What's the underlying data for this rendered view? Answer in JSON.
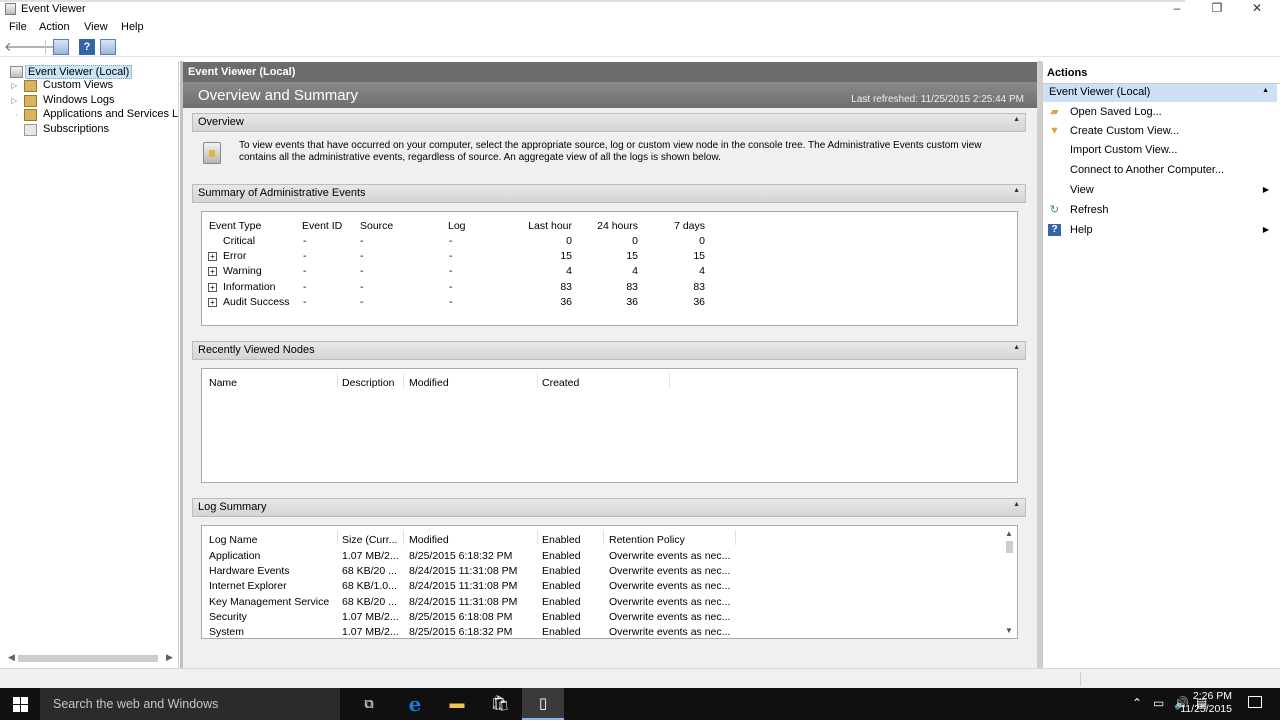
{
  "window": {
    "title": "Event Viewer",
    "controls": {
      "minimize": "–",
      "restore": "❐",
      "close": "✕"
    }
  },
  "menu": [
    "File",
    "Action",
    "View",
    "Help"
  ],
  "toolbar": {
    "back": "🡐",
    "forward": "🡒",
    "help": "?"
  },
  "tree": {
    "root": "Event Viewer (Local)",
    "items": [
      "Custom Views",
      "Windows Logs",
      "Applications and Services Lo",
      "Subscriptions"
    ]
  },
  "center": {
    "header": "Event Viewer (Local)",
    "banner_title": "Overview and Summary",
    "last_refreshed": "Last refreshed: 11/25/2015 2:25:44 PM",
    "overview": {
      "title": "Overview",
      "text": "To view events that have occurred on your computer, select the appropriate source, log or custom view node in the console tree. The Administrative Events custom view contains all the administrative events, regardless of source. An aggregate view of all the logs is shown below."
    },
    "summary": {
      "title": "Summary of Administrative Events",
      "columns": [
        "Event Type",
        "Event ID",
        "Source",
        "Log",
        "Last hour",
        "24 hours",
        "7 days"
      ],
      "rows": [
        {
          "expandable": false,
          "type": "Critical",
          "id": "-",
          "source": "-",
          "log": "-",
          "hour": "0",
          "day": "0",
          "week": "0"
        },
        {
          "expandable": true,
          "type": "Error",
          "id": "-",
          "source": "-",
          "log": "-",
          "hour": "15",
          "day": "15",
          "week": "15"
        },
        {
          "expandable": true,
          "type": "Warning",
          "id": "-",
          "source": "-",
          "log": "-",
          "hour": "4",
          "day": "4",
          "week": "4"
        },
        {
          "expandable": true,
          "type": "Information",
          "id": "-",
          "source": "-",
          "log": "-",
          "hour": "83",
          "day": "83",
          "week": "83"
        },
        {
          "expandable": true,
          "type": "Audit Success",
          "id": "-",
          "source": "-",
          "log": "-",
          "hour": "36",
          "day": "36",
          "week": "36"
        }
      ]
    },
    "recent": {
      "title": "Recently Viewed Nodes",
      "columns": [
        "Name",
        "Description",
        "Modified",
        "Created"
      ]
    },
    "log_summary": {
      "title": "Log Summary",
      "columns": [
        "Log Name",
        "Size (Curr...",
        "Modified",
        "Enabled",
        "Retention Policy"
      ],
      "rows": [
        {
          "name": "Application",
          "size": "1.07 MB/2...",
          "modified": "8/25/2015 6:18:32 PM",
          "enabled": "Enabled",
          "policy": "Overwrite events as nec..."
        },
        {
          "name": "Hardware Events",
          "size": "68 KB/20 ...",
          "modified": "8/24/2015 11:31:08 PM",
          "enabled": "Enabled",
          "policy": "Overwrite events as nec..."
        },
        {
          "name": "Internet Explorer",
          "size": "68 KB/1.0...",
          "modified": "8/24/2015 11:31:08 PM",
          "enabled": "Enabled",
          "policy": "Overwrite events as nec..."
        },
        {
          "name": "Key Management Service",
          "size": "68 KB/20 ...",
          "modified": "8/24/2015 11:31:08 PM",
          "enabled": "Enabled",
          "policy": "Overwrite events as nec..."
        },
        {
          "name": "Security",
          "size": "1.07 MB/2...",
          "modified": "8/25/2015 6:18:08 PM",
          "enabled": "Enabled",
          "policy": "Overwrite events as nec..."
        },
        {
          "name": "System",
          "size": "1.07 MB/2...",
          "modified": "8/25/2015 6:18:32 PM",
          "enabled": "Enabled",
          "policy": "Overwrite events as nec..."
        }
      ]
    }
  },
  "actions": {
    "title": "Actions",
    "group": "Event Viewer (Local)",
    "items": [
      {
        "label": "Open Saved Log...",
        "icon": "folder-icon",
        "submenu": false
      },
      {
        "label": "Create Custom View...",
        "icon": "filter-icon",
        "submenu": false
      },
      {
        "label": "Import Custom View...",
        "icon": "",
        "submenu": false
      },
      {
        "label": "Connect to Another Computer...",
        "icon": "",
        "submenu": false
      },
      {
        "label": "View",
        "icon": "",
        "submenu": true
      },
      {
        "label": "Refresh",
        "icon": "refresh-icon",
        "submenu": false
      },
      {
        "label": "Help",
        "icon": "help-icon",
        "submenu": true
      }
    ]
  },
  "taskbar": {
    "search_placeholder": "Search the web and Windows",
    "time": "2:26 PM",
    "date": "11/25/2015"
  },
  "colors": {
    "header_gray": "#6c6c6c",
    "actions_highlight": "#cde0f5",
    "taskbar_bg": "#101010",
    "edge_blue": "#1e78d6"
  }
}
